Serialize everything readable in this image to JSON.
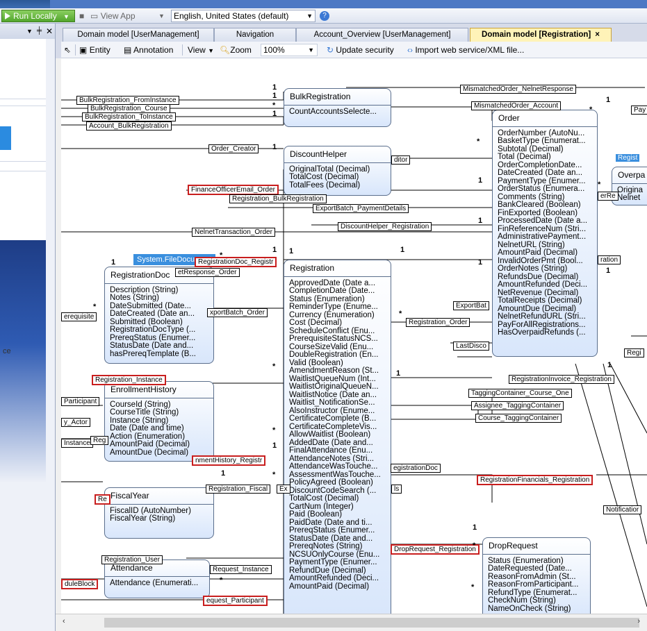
{
  "toolbar": {
    "run_label": "Run Locally",
    "view_app_label": "View App",
    "language": "English, United States (default)"
  },
  "tabs": [
    {
      "label": "Domain model [UserManagement]"
    },
    {
      "label": "Navigation"
    },
    {
      "label": "Account_Overview [UserManagement]"
    },
    {
      "label": "Domain model [Registration]",
      "close": "×"
    }
  ],
  "editor_toolbar": {
    "entity": "Entity",
    "annotation": "Annotation",
    "view": "View",
    "zoom_label": "Zoom",
    "zoom_value": "100%",
    "update_security": "Update security",
    "import": "Import web service/XML file..."
  },
  "left_panel": {
    "partial_text": "ce"
  },
  "system_badge": "System.FileDocument",
  "entities": {
    "bulk": {
      "name": "BulkRegistration",
      "attrs": [
        "CountAccountsSelecte..."
      ]
    },
    "discount": {
      "name": "DiscountHelper",
      "attrs": [
        "OriginalTotal (Decimal)",
        "TotalCost (Decimal)",
        "TotalFees (Decimal)"
      ]
    },
    "order": {
      "name": "Order",
      "attrs": [
        "OrderNumber (AutoNu...",
        "BasketType (Enumerat...",
        "Subtotal (Decimal)",
        "Total (Decimal)",
        "OrderCompletionDate...",
        "DateCreated (Date an...",
        "PaymentType (Enumer...",
        "OrderStatus (Enumera...",
        "Comments (String)",
        "BankCleared (Boolean)",
        "FinExported (Boolean)",
        "ProcessedDate (Date a...",
        "FinReferenceNum (Stri...",
        "AdministrativePayment...",
        "NelnetURL (String)",
        "AmountPaid (Decimal)",
        "InvalidOrderPmt (Bool...",
        "OrderNotes (String)",
        "RefundsDue (Decimal)",
        "AmountRefunded (Deci...",
        "NetRevenue (Decimal)",
        "TotalReceipts (Decimal)",
        "AmountDue (Decimal)",
        "NelnetRefundURL (Stri...",
        "PayForAllRegistrations...",
        "HasOverpaidRefunds (..."
      ]
    },
    "overpaid": {
      "name": "Overpa",
      "attrs": [
        "Origina",
        "Nelnet"
      ]
    },
    "regdoc": {
      "name": "RegistrationDoc",
      "attrs": [
        "Description (String)",
        "Notes (String)",
        "DateSubmitted (Date...",
        "DateCreated (Date an...",
        "Submitted (Boolean)",
        "RegistrationDocType (...",
        "PrereqStatus (Enumer...",
        "StatusDate (Date and...",
        "hasPrereqTemplate (B..."
      ]
    },
    "registration": {
      "name": "Registration",
      "attrs": [
        "ApprovedDate (Date a...",
        "CompletionDate (Date...",
        "Status (Enumeration)",
        "ReminderType (Enume...",
        "Currency (Enumeration)",
        "Cost (Decimal)",
        "ScheduleConflict (Enu...",
        "PrerequisiteStatusNCS...",
        "CourseSizeValid (Enu...",
        "DoubleRegistration (En...",
        "Valid (Boolean)",
        "AmendmentReason (St...",
        "WaitlistQueueNum (Int...",
        "WaitlistOriginalQueueN...",
        "WaitlistNotice (Date an...",
        "Waitlist_NotificationSe...",
        "AlsoInstructor (Enume...",
        "CertificateComplete (B...",
        "CertificateCompleteVis...",
        "AllowWaitlist (Boolean)",
        "AddedDate (Date and...",
        "FinalAttendance (Enu...",
        "AttendanceNotes (Stri...",
        "AttendanceWasTouche...",
        "AssessmentWasTouche...",
        "PolicyAgreed (Boolean)",
        "DiscountCodeSearch (...",
        "TotalCost (Decimal)",
        "CartNum (Integer)",
        "Paid (Boolean)",
        "PaidDate (Date and ti...",
        "PrereqStatus (Enumer...",
        "StatusDate (Date and...",
        "PrereqNotes (String)",
        "NCSUOnlyCourse (Enu...",
        "PaymentType (Enumer...",
        "RefundDue (Decimal)",
        "AmountRefunded (Deci...",
        "AmountPaid (Decimal)"
      ]
    },
    "enroll": {
      "name": "EnrollmentHistory",
      "attrs": [
        "CourseId (String)",
        "CourseTitle (String)",
        "Instance (String)",
        "Date (Date and time)",
        "Action (Enumeration)",
        "AmountPaid (Decimal)",
        "AmountDue (Decimal)"
      ]
    },
    "fiscal": {
      "name": "FiscalYear",
      "attrs": [
        "FiscalID (AutoNumber)",
        "FiscalYear (String)"
      ]
    },
    "attendance": {
      "name": "Attendance",
      "attrs": [
        "Attendance (Enumerati..."
      ]
    },
    "drop": {
      "name": "DropRequest",
      "attrs": [
        "Status (Enumeration)",
        "DateRequested (Date...",
        "ReasonFromAdmin (St...",
        "ReasonFromParticipant...",
        "RefundType (Enumerat...",
        "CheckNum (String)",
        "NameOnCheck (String)"
      ]
    }
  },
  "relations": {
    "bulk_from": "BulkRegistration_FromInstance",
    "bulk_course": "BulkRegistration_Course",
    "bulk_to": "BulkRegistration_ToInstance",
    "acct_bulk": "Account_BulkRegistration",
    "mismatch_nelnet": "MismatchedOrder_NelnetResponse",
    "mismatch_acct": "MismatchedOrder_Account",
    "pay_partial": "Pay",
    "order_creator": "Order_Creator",
    "editor_partial": "ditor",
    "regi_partial": "Regist",
    "finance_email": "FinanceOfficerEmail_Order",
    "reg_bulk": "Registration_BulkRegistration",
    "er_partial": "erRe",
    "export_payment": "ExportBatch_PaymentDetails",
    "discount_reg": "DiscountHelper_Registration",
    "nelnet_trans": "NelnetTransaction_Order",
    "regdoc_reg": "RegistrationDoc_Registr",
    "nelnet_resp": "etResponse_Order",
    "ration_partial": "ration",
    "prereq_partial": "erequisite",
    "export_order": "xportBatch_Order",
    "exportbat_partial": "ExportBat",
    "reg_order": "Registration_Order",
    "lastdisco_partial": "LastDisco",
    "regi2_partial": "Regi",
    "reg_instance": "Registration_Instance",
    "reginvoice": "RegistrationInvoice_Registration",
    "participant_partial": "Participant",
    "tagging_course": "TaggingContainer_Course_One",
    "assignee_tag": "Assignee_TaggingContainer",
    "actor_partial": "y_Actor",
    "course_tag": "Course_TaggingContainer",
    "instance_partial": "Instance",
    "reg_partial_small": "Reg",
    "enroll_reg": "nmentHistory_Registr",
    "regdoc_partial": "egistrationDoc",
    "reg_fiscal": "Registration_Fiscal",
    "ex_partial": "Ex",
    "ls_partial": "ls",
    "re_partial": "Re",
    "regfin": "RegistrationFinancials_Registration",
    "notif_partial": "Notificatior",
    "reg_user": "Registration_User",
    "request_instance": "Request_Instance",
    "drop_reg": "DropRequest_Registration",
    "module_partial": "duleBlock",
    "request_participant": "equest_Participant"
  },
  "multiplicities": {
    "one": "1",
    "many": "*"
  }
}
